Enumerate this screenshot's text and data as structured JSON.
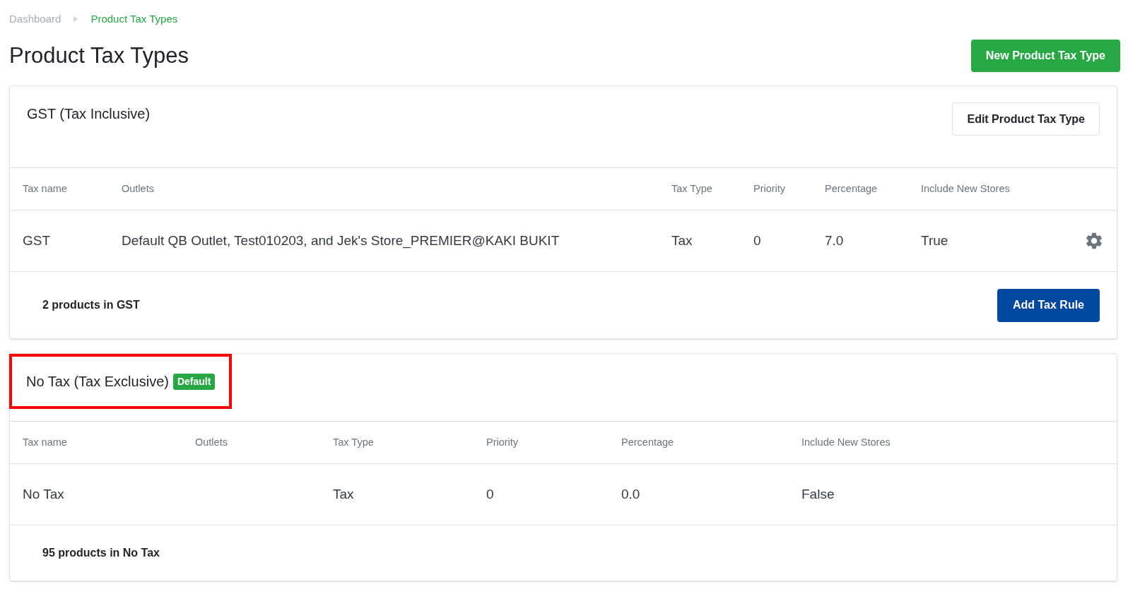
{
  "breadcrumb": [
    {
      "label": "Dashboard",
      "selected": false
    },
    {
      "label": "Product Tax Types",
      "selected": true
    }
  ],
  "page_title": "Product Tax Types",
  "primary_action": "New Product Tax Type",
  "tax_types": [
    {
      "title": "GST (Tax Inclusive)",
      "highlighted": false,
      "edit_button": "Edit Product Tax Type",
      "columns": [
        "Tax name",
        "Outlets",
        "Tax Type",
        "Priority",
        "Percentage",
        "Include New Stores"
      ],
      "rows": [
        {
          "cells": [
            "GST",
            "Default QB Outlet, Test010203, and Jek's Store_PREMIER@KAKI BUKIT",
            "Tax",
            "0",
            "7.0",
            "True"
          ],
          "settings": true
        }
      ],
      "footer": "2 products in GST",
      "footer_button": "Add Tax Rule"
    },
    {
      "title": "No Tax (Tax Exclusive)",
      "badge": "Default",
      "highlighted": true,
      "columns": [
        "Tax name",
        "Outlets",
        "Tax Type",
        "Priority",
        "Percentage",
        "Include New Stores"
      ],
      "rows": [
        {
          "cells": [
            "No Tax",
            "",
            "Tax",
            "0",
            "0.0",
            "False"
          ],
          "settings": false
        }
      ],
      "footer": "95 products in No Tax"
    }
  ]
}
